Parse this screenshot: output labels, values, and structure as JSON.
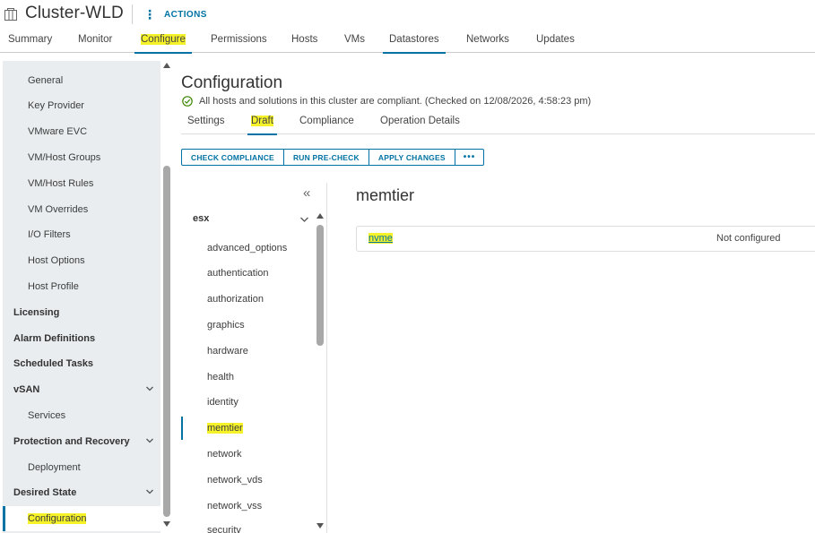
{
  "header": {
    "title": "Cluster-WLD",
    "actions_label": "ACTIONS"
  },
  "tabs": [
    {
      "label": "Summary"
    },
    {
      "label": "Monitor"
    },
    {
      "label": "Configure"
    },
    {
      "label": "Permissions"
    },
    {
      "label": "Hosts"
    },
    {
      "label": "VMs"
    },
    {
      "label": "Datastores"
    },
    {
      "label": "Networks"
    },
    {
      "label": "Updates"
    }
  ],
  "sidebar": {
    "items": [
      {
        "label": "General"
      },
      {
        "label": "Key Provider"
      },
      {
        "label": "VMware EVC"
      },
      {
        "label": "VM/Host Groups"
      },
      {
        "label": "VM/Host Rules"
      },
      {
        "label": "VM Overrides"
      },
      {
        "label": "I/O Filters"
      },
      {
        "label": "Host Options"
      },
      {
        "label": "Host Profile"
      },
      {
        "label": "Licensing"
      },
      {
        "label": "Alarm Definitions"
      },
      {
        "label": "Scheduled Tasks"
      },
      {
        "label": "vSAN"
      },
      {
        "label": "Services"
      },
      {
        "label": "Protection and Recovery"
      },
      {
        "label": "Deployment"
      },
      {
        "label": "Desired State"
      },
      {
        "label": "Configuration"
      }
    ]
  },
  "main": {
    "title": "Configuration",
    "status": "All hosts and solutions in this cluster are compliant. (Checked on 12/08/2026, 4:58:23 pm)",
    "subtabs": [
      {
        "label": "Settings"
      },
      {
        "label": "Draft"
      },
      {
        "label": "Compliance"
      },
      {
        "label": "Operation Details"
      }
    ],
    "buttons": {
      "check_compliance": "CHECK COMPLIANCE",
      "run_precheck": "RUN PRE-CHECK",
      "apply_changes": "APPLY CHANGES",
      "more": "•••"
    }
  },
  "tree": {
    "collapse": "«",
    "root": "esx",
    "items": [
      {
        "label": "advanced_options"
      },
      {
        "label": "authentication"
      },
      {
        "label": "authorization"
      },
      {
        "label": "graphics"
      },
      {
        "label": "hardware"
      },
      {
        "label": "health"
      },
      {
        "label": "identity"
      },
      {
        "label": "memtier"
      },
      {
        "label": "network"
      },
      {
        "label": "network_vds"
      },
      {
        "label": "network_vss"
      },
      {
        "label": "security"
      }
    ]
  },
  "detail": {
    "title": "memtier",
    "rows": [
      {
        "name": "nvme",
        "value": "Not configured"
      }
    ]
  },
  "colors": {
    "accent": "#0072a3",
    "highlight": "#f5f22a",
    "sidebar_bg": "#e9edf0",
    "success": "#3c8500"
  }
}
